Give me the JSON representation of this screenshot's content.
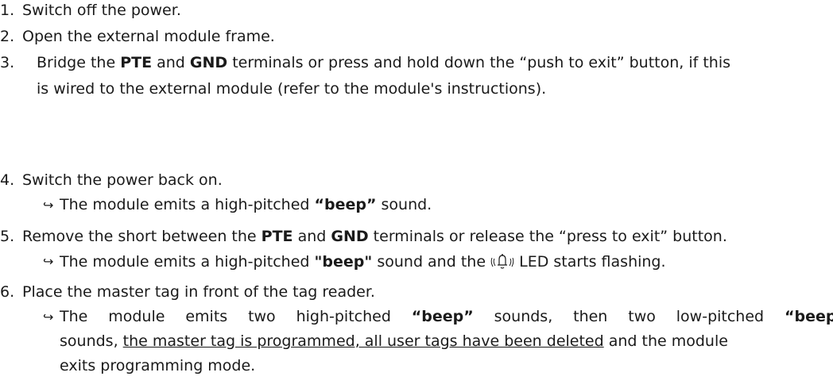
{
  "steps": [
    {
      "num": "1.",
      "text": "Switch off the power."
    },
    {
      "num": "2.",
      "text": "Open the external module frame."
    },
    {
      "num": "3.",
      "pre": "Bridge the ",
      "b1": "PTE",
      "mid": " and ",
      "b2": "GND",
      "post": " terminals or press and hold down the “push to exit” button, if this",
      "cont": "is wired to the external module (refer to the module's instructions)."
    },
    {
      "num": "4.",
      "text": "Switch the power back on.",
      "result_pre": "The module emits a high-pitched ",
      "result_b": "“beep”",
      "result_post": " sound."
    },
    {
      "num": "5.",
      "pre": "Remove the short between the ",
      "b1": "PTE",
      "mid": " and ",
      "b2": "GND",
      "post": " terminals or release the “press to exit” button.",
      "result_pre": "The module emits a high-pitched ",
      "result_b": "\"beep\"",
      "result_mid": " sound and the ",
      "result_post": " LED starts flashing."
    },
    {
      "num": "6.",
      "text": "Place the master tag in front of the tag reader.",
      "r1": [
        "The",
        "module",
        "emits",
        "two",
        "high-pitched",
        "“beep”",
        "sounds,",
        "then",
        "two",
        "low-pitched",
        "“beep”"
      ],
      "r2_pre": "sounds, ",
      "r2_u": "the master tag is programmed, all user tags have been deleted",
      "r2_post": " and the module",
      "r3": "exits programming mode."
    }
  ],
  "result_arrow": "↪",
  "icons": {
    "bell": "bell-led-icon"
  }
}
